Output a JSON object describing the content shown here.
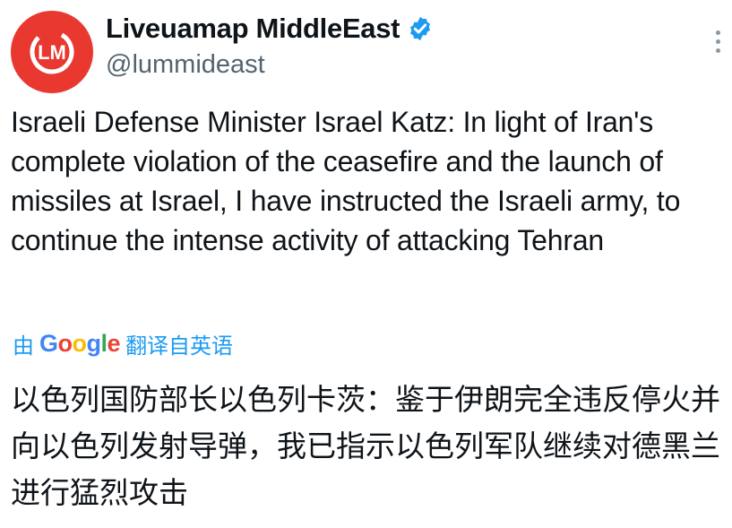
{
  "account": {
    "display_name": "Liveuamap MiddleEast",
    "handle": "@lummideast",
    "avatar_letters": "LM",
    "brand_color": "#e8382f",
    "verified_color": "#1d9bf0"
  },
  "tweet": {
    "text": "Israeli Defense Minister Israel Katz: In light of Iran's complete violation of the ceasefire and the launch of missiles at Israel, I have instructed the Israeli army, to continue the intense activity of attacking Tehran"
  },
  "translation": {
    "prefix": "由",
    "provider_letters": [
      "G",
      "o",
      "o",
      "g",
      "l",
      "e"
    ],
    "suffix": "翻译自英语",
    "text": "以色列国防部长以色列卡茨：鉴于伊朗完全违反停火并向以色列发射导弹，我已指示以色列军队继续对德黑兰进行猛烈攻击"
  },
  "icons": {
    "verified": "verified-badge-icon",
    "more": "more-options-icon"
  }
}
